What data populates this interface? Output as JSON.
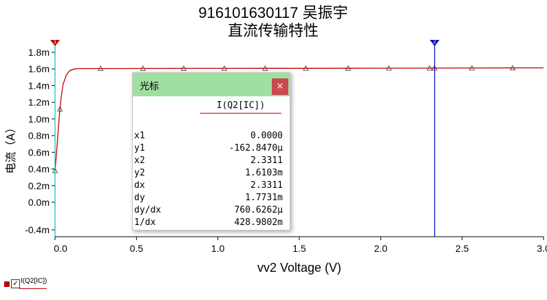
{
  "title_line1": "916101630117 吴振宇",
  "title_line2": "直流传输特性",
  "chart_data": {
    "type": "line",
    "xlabel": "vv2 Voltage (V)",
    "ylabel": "电流（A）",
    "xlim": [
      0,
      3.0
    ],
    "ylim": [
      -0.4,
      1.9
    ],
    "xticks": [
      "0.0",
      "0.5",
      "1.0",
      "1.5",
      "2.0",
      "2.5",
      "3.0"
    ],
    "xtick_values": [
      0,
      0.5,
      1.0,
      1.5,
      2.0,
      2.5,
      3.0
    ],
    "yticks": [
      "1.8m",
      "1.6m",
      "1.4m",
      "1.2m",
      "1.0m",
      "0.8m",
      "0.6m",
      "0.4m",
      "0.2m",
      "0.0m",
      "-0.4m"
    ],
    "ytick_values": [
      1.8,
      1.6,
      1.4,
      1.2,
      1.0,
      0.8,
      0.6,
      0.4,
      0.2,
      0.0,
      -0.4
    ],
    "series": [
      {
        "name": "I(Q2[IC])",
        "color": "#c00000",
        "x": [
          0.0,
          0.01,
          0.02,
          0.03,
          0.04,
          0.05,
          0.07,
          0.09,
          0.12,
          0.15,
          0.2,
          0.3,
          0.5,
          0.8,
          1.0,
          1.3,
          1.5,
          1.8,
          2.0,
          2.33,
          2.5,
          2.8,
          3.0
        ],
        "y": [
          0.38,
          0.62,
          0.88,
          1.12,
          1.3,
          1.42,
          1.53,
          1.58,
          1.6,
          1.605,
          1.605,
          1.6053,
          1.606,
          1.6065,
          1.607,
          1.6075,
          1.608,
          1.6085,
          1.609,
          1.6103,
          1.611,
          1.6125,
          1.613
        ]
      }
    ],
    "markers_x": [
      0.0,
      0.03,
      0.28,
      0.54,
      0.79,
      1.04,
      1.29,
      1.54,
      1.8,
      2.05,
      2.3,
      2.33,
      2.56,
      2.81
    ],
    "cursor1_x": 0.0,
    "cursor2_x": 2.3311,
    "cursor1_color": "#00c0c0",
    "cursor2_color": "#0000c0",
    "cursor1_label": "1",
    "cursor2_label": "2"
  },
  "cursor_window": {
    "title": "光标",
    "close": "×",
    "column": "I(Q2[IC])",
    "rows": [
      {
        "k": "x1",
        "v": "0.0000"
      },
      {
        "k": "y1",
        "v": "-162.8470μ"
      },
      {
        "k": "x2",
        "v": "2.3311"
      },
      {
        "k": "y2",
        "v": "1.6103m"
      },
      {
        "k": "dx",
        "v": "2.3311"
      },
      {
        "k": "dy",
        "v": "1.7731m"
      },
      {
        "k": "dy/dx",
        "v": "760.6262μ"
      },
      {
        "k": "1/dx",
        "v": "428.9802m"
      }
    ]
  },
  "legend": {
    "label": "I(Q2[IC])",
    "checked": "✓",
    "color": "#c00000"
  }
}
